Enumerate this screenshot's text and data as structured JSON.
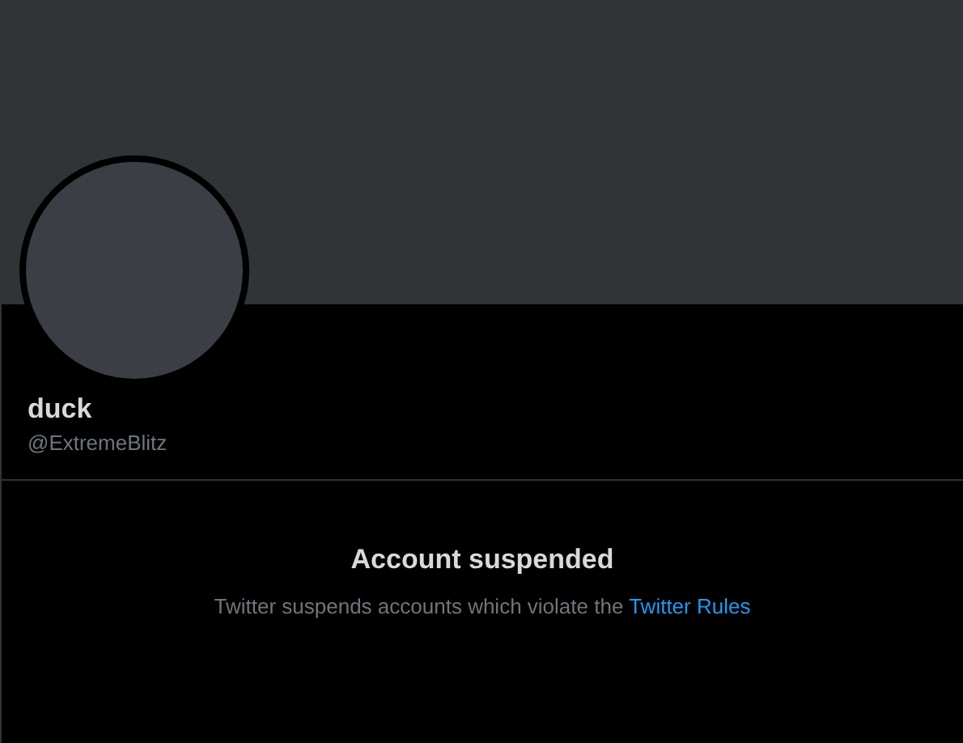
{
  "profile": {
    "name": "duck",
    "handle": "@ExtremeBlitz"
  },
  "notice": {
    "title": "Account suspended",
    "text": "Twitter suspends accounts which violate the",
    "link": "Twitter Rules"
  }
}
